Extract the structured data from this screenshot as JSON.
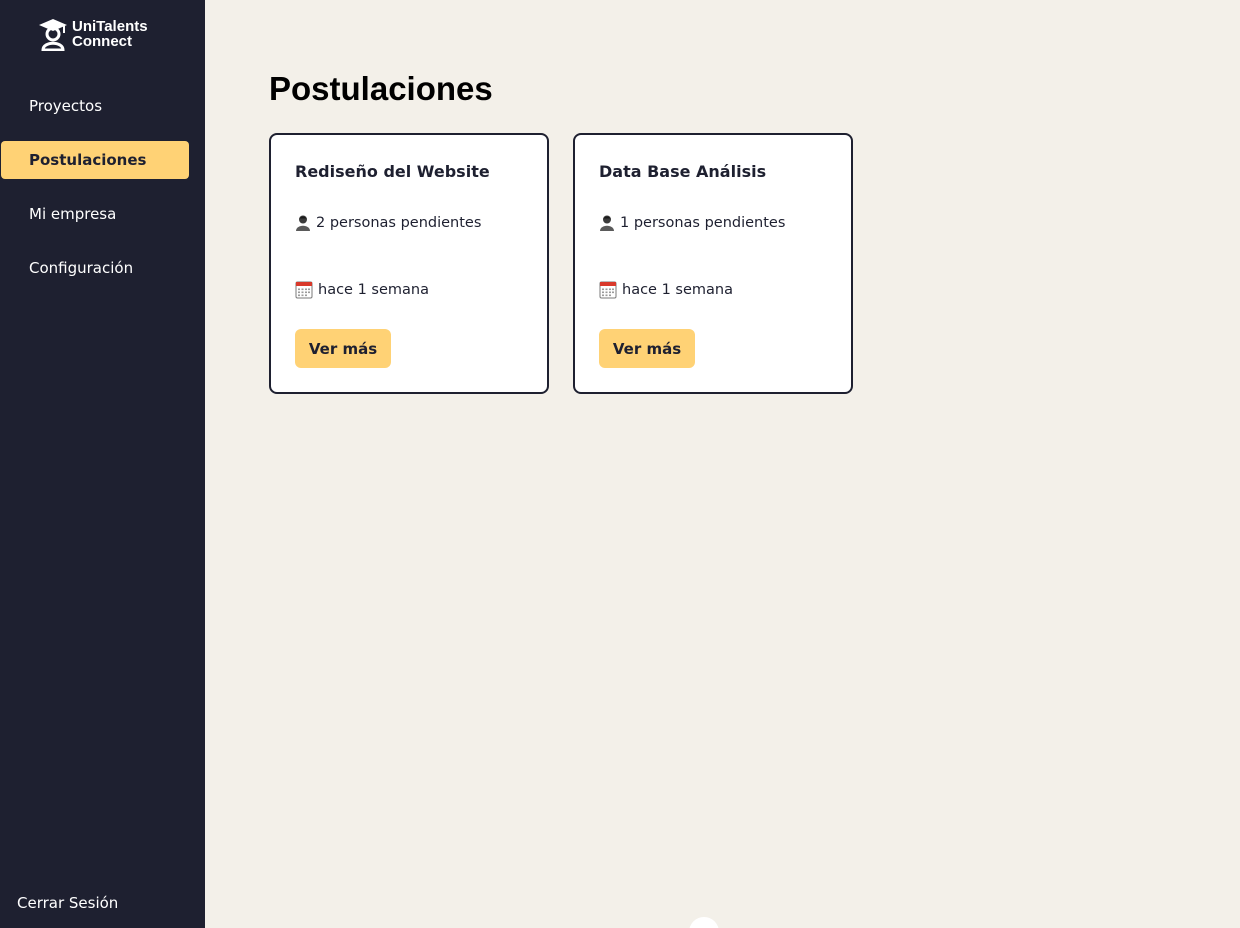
{
  "brand": {
    "name_line1": "UniTalents",
    "name_line2": "Connect",
    "icon": "graduate-logo-icon"
  },
  "sidebar": {
    "items": [
      {
        "label": "Proyectos",
        "active": false
      },
      {
        "label": "Postulaciones",
        "active": true
      },
      {
        "label": "Mi empresa",
        "active": false
      },
      {
        "label": "Configuración",
        "active": false
      }
    ],
    "logout_label": "Cerrar Sesión"
  },
  "main": {
    "title": "Postulaciones",
    "cards": [
      {
        "title": "Rediseño del Website",
        "pending": "2 personas pendientes",
        "pending_icon": "person-icon",
        "date": "hace 1 semana",
        "date_icon": "calendar-icon",
        "button_label": "Ver más"
      },
      {
        "title": "Data Base Análisis",
        "pending": "1 personas pendientes",
        "pending_icon": "person-icon",
        "date": "hace 1 semana",
        "date_icon": "calendar-icon",
        "button_label": "Ver más"
      }
    ]
  },
  "colors": {
    "sidebar_bg": "#1e2030",
    "page_bg": "#f3f0e9",
    "accent": "#ffd275",
    "card_border": "#1e2030"
  }
}
